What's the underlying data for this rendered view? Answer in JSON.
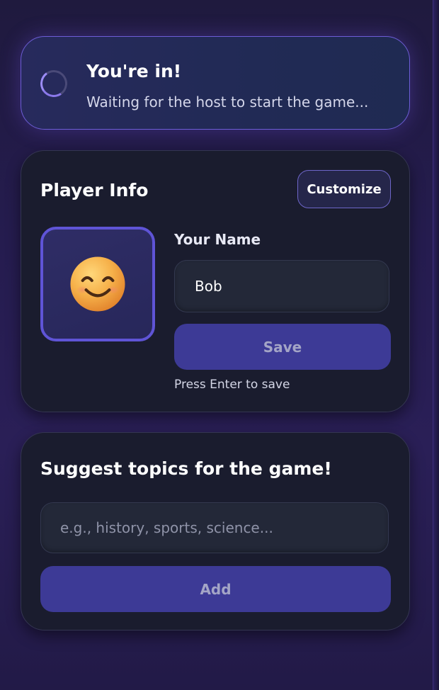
{
  "status": {
    "title": "You're in!",
    "subtitle": "Waiting for the host to start the game..."
  },
  "player_info": {
    "title": "Player Info",
    "customize_label": "Customize",
    "avatar_icon": "smiling-face-emoji",
    "name_label": "Your Name",
    "name_value": "Bob",
    "save_label": "Save",
    "hint": "Press Enter to save"
  },
  "topics": {
    "title": "Suggest topics for the game!",
    "placeholder": "e.g., history, sports, science...",
    "add_label": "Add"
  },
  "colors": {
    "accent": "#5f54d6",
    "button_bg": "#3d3a96",
    "card_bg": "#1a1c2e",
    "page_bg": "#251c4f"
  }
}
